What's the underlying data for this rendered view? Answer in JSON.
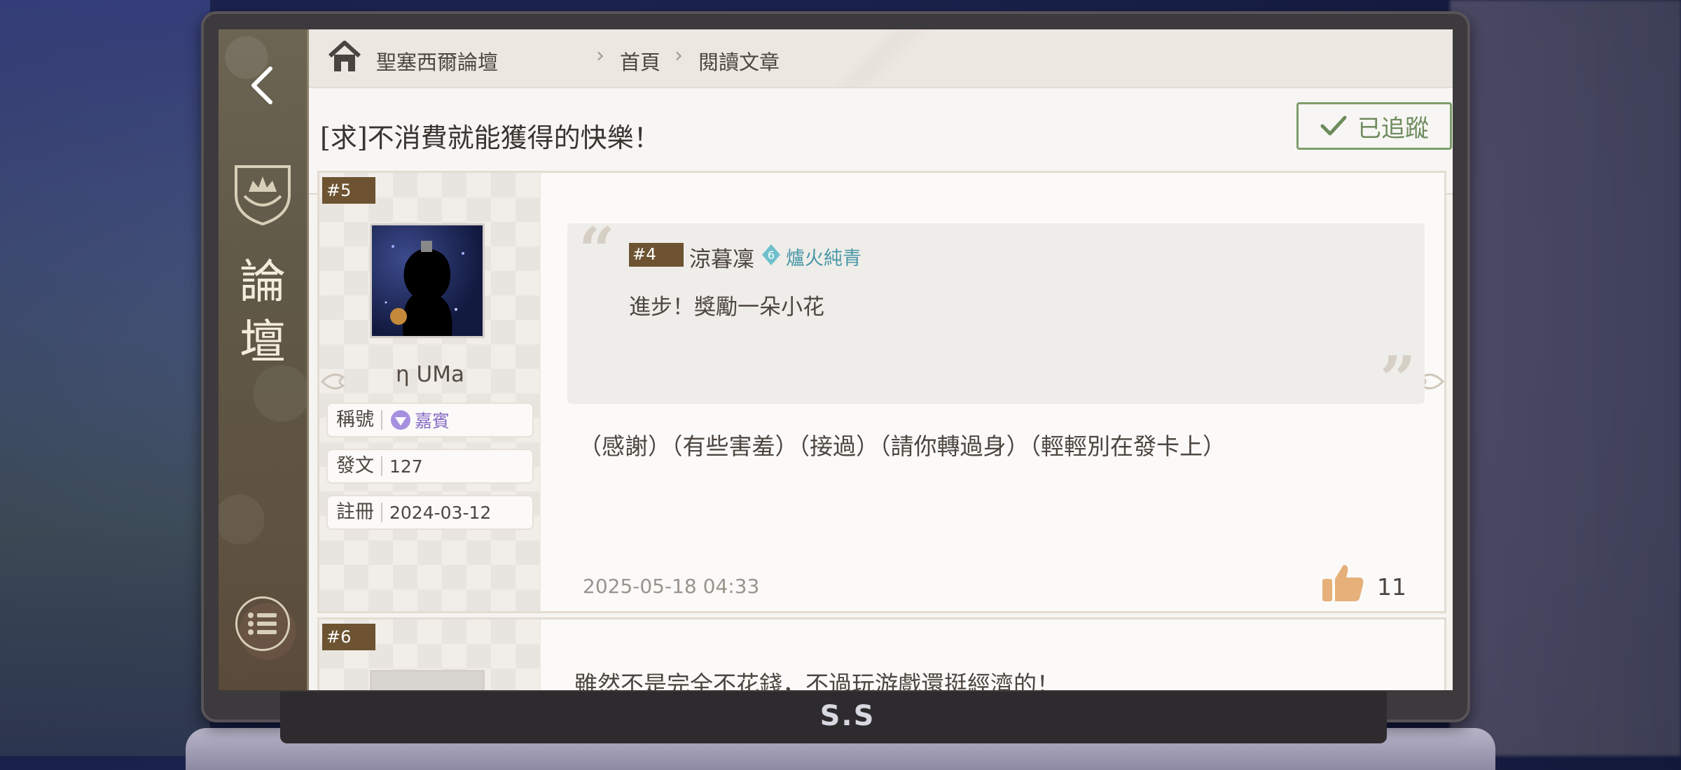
{
  "breadcrumb": {
    "forum": "聖塞西爾論壇",
    "home": "首頁",
    "current": "閱讀文章"
  },
  "sidebar": {
    "title_line1": "論",
    "title_line2": "壇"
  },
  "post_title": "[求]不消費就能獲得的快樂！",
  "follow_button": {
    "label": "已追蹤",
    "color": "#7e9d6a"
  },
  "posts": [
    {
      "floor": "#5",
      "username": "η UMa",
      "info": [
        {
          "key": "稱號",
          "value": "嘉賓"
        },
        {
          "key": "發文",
          "value": "127"
        },
        {
          "key": "註冊",
          "value": "2024-03-12"
        }
      ],
      "quote": {
        "floor": "#4",
        "author": "涼暮凜",
        "badge_level": "6",
        "author_title": "爐火純青",
        "text": "進步！獎勵一朵小花"
      },
      "body": "（感謝）（有些害羞）（接過）（請你轉過身）（輕輕別在發卡上）",
      "time": "2025-05-18 04:33",
      "likes": "11"
    },
    {
      "floor": "#6",
      "body": "雖然不是完全不花錢，不過玩游戲還挺經濟的！"
    }
  ],
  "device_logo": "S.S",
  "colors": {
    "floor_tag": "#6d5331",
    "accent_teal": "#4a98a8",
    "title_purple": "#8a6fc8",
    "like": "#e6b07a"
  }
}
